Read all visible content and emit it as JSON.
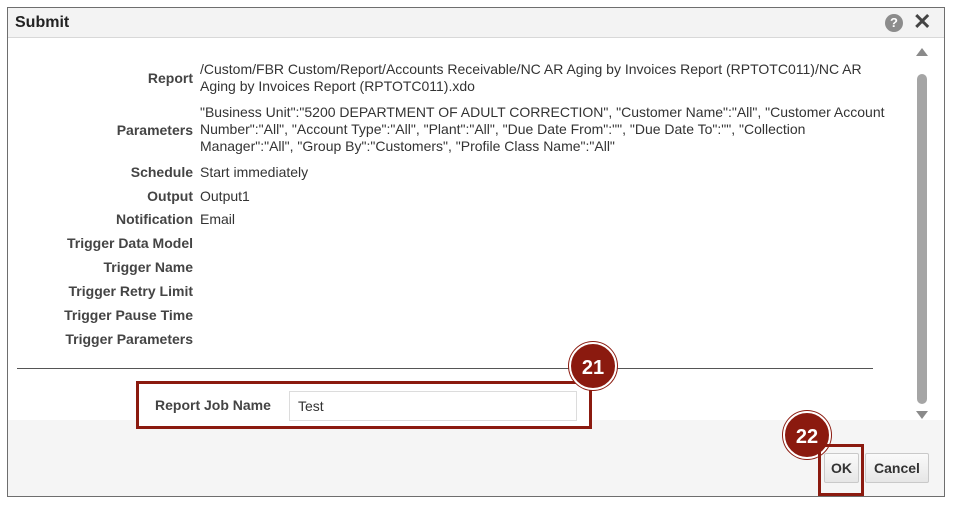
{
  "dialog": {
    "title": "Submit",
    "help_icon": "?",
    "close_icon": "✕"
  },
  "details": [
    {
      "label": "Report",
      "value": "/Custom/FBR Custom/Report/Accounts Receivable/NC AR Aging by Invoices Report (RPTOTC011)/NC AR Aging by Invoices Report (RPTOTC011).xdo"
    },
    {
      "label": "Parameters",
      "value": "\"Business Unit\":\"5200 DEPARTMENT OF ADULT CORRECTION\", \"Customer Name\":\"All\", \"Customer Account Number\":\"All\", \"Account Type\":\"All\", \"Plant\":\"All\", \"Due Date From\":\"\", \"Due Date To\":\"\", \"Collection Manager\":\"All\", \"Group By\":\"Customers\", \"Profile Class Name\":\"All\""
    },
    {
      "label": "Schedule",
      "value": "Start immediately"
    },
    {
      "label": "Output",
      "value": "Output1"
    },
    {
      "label": "Notification",
      "value": "Email"
    },
    {
      "label": "Trigger Data Model",
      "value": ""
    },
    {
      "label": "Trigger Name",
      "value": ""
    },
    {
      "label": "Trigger Retry Limit",
      "value": ""
    },
    {
      "label": "Trigger Pause Time",
      "value": ""
    },
    {
      "label": "Trigger Parameters",
      "value": ""
    }
  ],
  "report_job_name": {
    "label": "Report Job Name",
    "value": "Test"
  },
  "callouts": {
    "step_21": "21",
    "step_22": "22"
  },
  "buttons": {
    "ok": "OK",
    "cancel": "Cancel"
  },
  "colors": {
    "callout": "#8b1a0f",
    "titlebar": "#f3f3f3"
  }
}
